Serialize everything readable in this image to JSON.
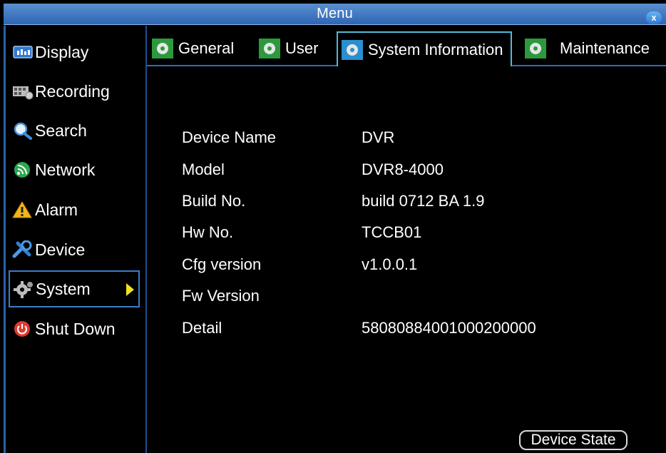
{
  "window": {
    "title": "Menu",
    "close_glyph": "x"
  },
  "sidebar": {
    "items": [
      {
        "label": "Display",
        "icon": "display-icon"
      },
      {
        "label": "Recording",
        "icon": "recording-icon"
      },
      {
        "label": "Search",
        "icon": "search-icon"
      },
      {
        "label": "Network",
        "icon": "network-icon"
      },
      {
        "label": "Alarm",
        "icon": "alarm-icon"
      },
      {
        "label": "Device",
        "icon": "device-icon"
      },
      {
        "label": "System",
        "icon": "system-gear-icon",
        "selected": true
      },
      {
        "label": "Shut Down",
        "icon": "power-icon"
      }
    ]
  },
  "tabs": [
    {
      "label": "General",
      "icon": "gear-icon"
    },
    {
      "label": "User",
      "icon": "gear-icon"
    },
    {
      "label": "System Information",
      "icon": "gear-icon",
      "active": true
    },
    {
      "label": "Maintenance",
      "icon": "gear-icon"
    }
  ],
  "info": [
    {
      "label": "Device Name",
      "value": "DVR"
    },
    {
      "label": "Model",
      "value": "DVR8-4000"
    },
    {
      "label": "Build No.",
      "value": "build 0712 BA 1.9"
    },
    {
      "label": "Hw No.",
      "value": "TCCB01"
    },
    {
      "label": "Cfg version",
      "value": "v1.0.0.1"
    },
    {
      "label": "Fw Version",
      "value": ""
    },
    {
      "label": "Detail",
      "value": "58080884001000200000"
    }
  ],
  "footer": {
    "device_state_label": "Device State"
  },
  "colors": {
    "titlebar": "#2f66b4",
    "accent": "#2d6cc0",
    "active_tab_border": "#54b8d8",
    "selection_arrow": "#f1e21a",
    "background": "#000000"
  }
}
